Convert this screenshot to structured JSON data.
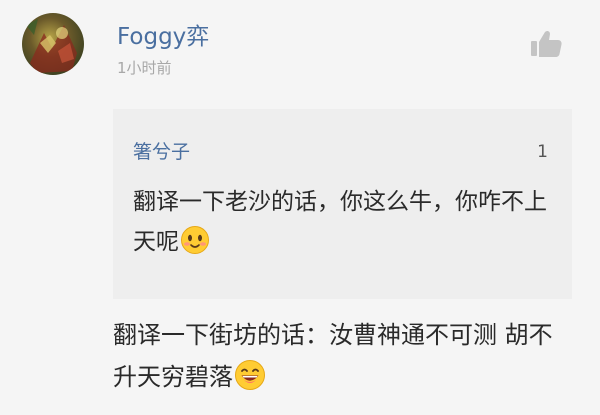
{
  "comment": {
    "username": "Foggy弈",
    "timestamp": "1小时前",
    "reply_text": "翻译一下街坊的话：汝曹神通不可测 胡不升天穷碧落",
    "reply_emoji": "grinning-face-emoji"
  },
  "quote": {
    "author": "箸兮子",
    "like_count": "1",
    "text": "翻译一下老沙的话，你这么牛，你咋不上天呢",
    "emoji": "smiling-blush-face-emoji"
  },
  "icons": {
    "like": "thumbs-up-icon",
    "avatar": "user-avatar"
  },
  "colors": {
    "username": "#4a6fa0",
    "background": "#f5f5f5",
    "quote_background": "#eeeeee",
    "text": "#2a2a2a",
    "muted": "#a8a8a8"
  }
}
